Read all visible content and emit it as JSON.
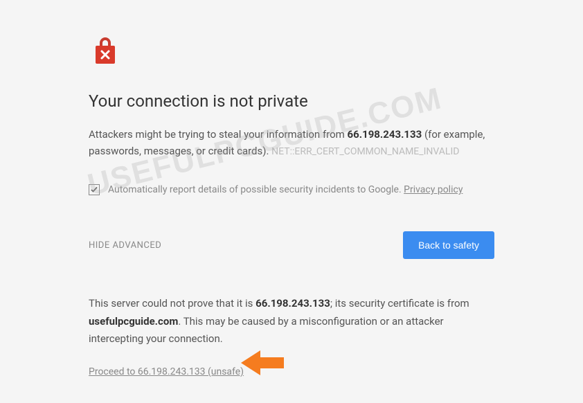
{
  "title": "Your connection is not private",
  "warning": {
    "prefix": "Attackers might be trying to steal your information from ",
    "ip": "66.198.243.133",
    "suffix": " (for example, passwords, messages, or credit cards). ",
    "error_code": "NET::ERR_CERT_COMMON_NAME_INVALID"
  },
  "checkbox": {
    "label_prefix": "Automatically report details of possible security incidents to Google. ",
    "privacy_link": "Privacy policy"
  },
  "actions": {
    "hide_advanced": "HIDE ADVANCED",
    "back_to_safety": "Back to safety"
  },
  "cert": {
    "line1_prefix": "This server could not prove that it is ",
    "ip": "66.198.243.133",
    "line1_mid": "; its security certificate is from ",
    "domain": "usefulpcguide.com",
    "line1_suffix": ". This may be caused by a misconfiguration or an attacker intercepting your connection."
  },
  "proceed": "Proceed to 66.198.243.133 (unsafe)",
  "watermark": "USEFULPCGUIDE.COM"
}
